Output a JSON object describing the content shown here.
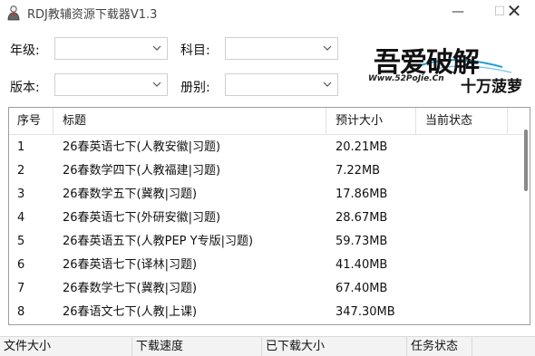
{
  "window": {
    "title": "RDJ教辅资源下载器V1.3",
    "minimize_glyph": "—",
    "maximize_glyph": "☐",
    "close_glyph": "✕"
  },
  "filters": {
    "grade_label": "年级:",
    "grade_value": "",
    "subject_label": "科目:",
    "subject_value": "",
    "edition_label": "版本:",
    "edition_value": "",
    "volume_label": "册别:",
    "volume_value": ""
  },
  "logo": {
    "main": "吾爱破解",
    "url": "Www.52PoJie.Cn",
    "slogan": "十万菠萝"
  },
  "table": {
    "columns": [
      "序号",
      "标题",
      "预计大小",
      "当前状态"
    ],
    "rows": [
      {
        "index": "1",
        "title": "26春英语七下(人教安徽|习题)",
        "size": "20.21MB",
        "status": ""
      },
      {
        "index": "2",
        "title": "26春数学四下(人教福建|习题)",
        "size": "7.22MB",
        "status": ""
      },
      {
        "index": "3",
        "title": "26春数学五下(冀教|习题)",
        "size": "17.86MB",
        "status": ""
      },
      {
        "index": "4",
        "title": "26春英语七下(外研安徽|习题)",
        "size": "28.67MB",
        "status": ""
      },
      {
        "index": "5",
        "title": "26春英语五下(人教PEP Y专版|习题)",
        "size": "59.73MB",
        "status": ""
      },
      {
        "index": "6",
        "title": "26春英语七下(译林|习题)",
        "size": "41.40MB",
        "status": ""
      },
      {
        "index": "7",
        "title": "26春数学七下(冀教|习题)",
        "size": "67.40MB",
        "status": ""
      },
      {
        "index": "8",
        "title": "26春语文七下(人教|上课)",
        "size": "347.30MB",
        "status": ""
      }
    ],
    "scroll_position": 0.1
  },
  "statusbar": {
    "file_size": "文件大小",
    "download_speed": "下载速度",
    "downloaded_size": "已下载大小",
    "task_status": "任务状态"
  },
  "colors": {
    "border": "#9d9d9d",
    "scroll_thumb": "#8a8a8a",
    "statusbar_bg": "#f3f3f3"
  },
  "icons": {
    "app": "app-person-icon",
    "dropdown": "chevron-down-icon"
  }
}
